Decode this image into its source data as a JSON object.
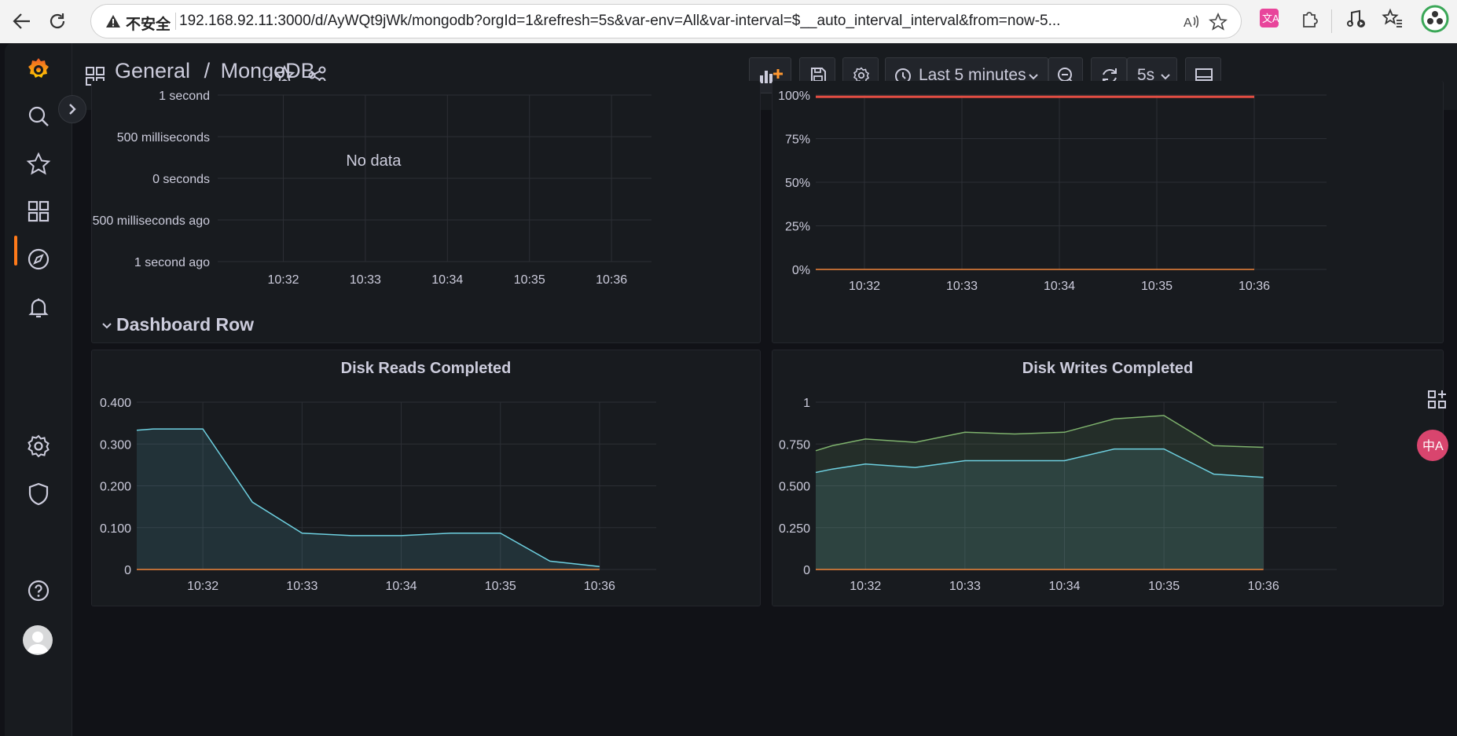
{
  "browser": {
    "insecure_label": "不安全",
    "url": "192.168.92.11:3000/d/AyWQt9jWk/mongodb?orgId=1&refresh=5s&var-env=All&var-interval=$__auto_interval_interval&from=now-5..."
  },
  "header": {
    "breadcrumb_folder": "General",
    "breadcrumb_sep": "/",
    "breadcrumb_dashboard": "MongoDB",
    "time_range": "Last 5 minutes",
    "refresh_interval": "5s"
  },
  "row": {
    "title": "Dashboard Row"
  },
  "colors": {
    "accent": "#ff7a1a",
    "series_cyan": "#6ed0e0",
    "series_green": "#7eb26d",
    "series_orange": "#ef843c",
    "series_red": "#e24d42"
  },
  "chart_data": [
    {
      "type": "line",
      "title": "",
      "no_data_label": "No data",
      "x_ticks": [
        "10:32",
        "10:33",
        "10:34",
        "10:35",
        "10:36"
      ],
      "y_ticks": [
        "1 second",
        "500 milliseconds",
        "0 seconds",
        "500 milliseconds ago",
        "1 second ago"
      ],
      "series": []
    },
    {
      "type": "line",
      "title": "",
      "x_ticks": [
        "10:32",
        "10:33",
        "10:34",
        "10:35",
        "10:36"
      ],
      "y_ticks": [
        "100%",
        "75%",
        "50%",
        "25%",
        "0%"
      ],
      "ylim": [
        0,
        100
      ],
      "x": [
        "10:31:30",
        "10:32",
        "10:32:30",
        "10:33",
        "10:33:30",
        "10:34",
        "10:34:30",
        "10:35",
        "10:35:30",
        "10:36"
      ],
      "series": [
        {
          "color": "#e24d42",
          "values": [
            99,
            99,
            99,
            99,
            99,
            99,
            99,
            99,
            99,
            99
          ]
        },
        {
          "color": "#ef843c",
          "values": [
            0,
            0,
            0,
            0,
            0,
            0,
            0,
            0,
            0,
            0
          ]
        }
      ]
    },
    {
      "type": "area",
      "title": "Disk Reads Completed",
      "x_ticks": [
        "10:32",
        "10:33",
        "10:34",
        "10:35",
        "10:36"
      ],
      "y_ticks": [
        "0.400",
        "0.300",
        "0.200",
        "0.100",
        "0"
      ],
      "ylim": [
        0,
        0.4
      ],
      "x": [
        "10:31:20",
        "10:31:30",
        "10:32",
        "10:32:30",
        "10:33",
        "10:33:30",
        "10:34",
        "10:34:30",
        "10:35",
        "10:35:30",
        "10:36"
      ],
      "series": [
        {
          "color": "#6ed0e0",
          "values": [
            0.333,
            0.336,
            0.336,
            0.161,
            0.087,
            0.081,
            0.081,
            0.087,
            0.087,
            0.02,
            0.007
          ]
        },
        {
          "color": "#ef843c",
          "values": [
            0,
            0,
            0,
            0,
            0,
            0,
            0,
            0,
            0,
            0,
            0
          ]
        }
      ]
    },
    {
      "type": "area",
      "title": "Disk Writes Completed",
      "x_ticks": [
        "10:32",
        "10:33",
        "10:34",
        "10:35",
        "10:36"
      ],
      "y_ticks": [
        "1",
        "0.750",
        "0.500",
        "0.250",
        "0"
      ],
      "ylim": [
        0,
        1
      ],
      "x": [
        "10:31:30",
        "10:31:40",
        "10:32",
        "10:32:30",
        "10:33",
        "10:33:30",
        "10:34",
        "10:34:30",
        "10:35",
        "10:35:30",
        "10:36"
      ],
      "series": [
        {
          "color": "#7eb26d",
          "values": [
            0.71,
            0.74,
            0.78,
            0.76,
            0.82,
            0.81,
            0.82,
            0.9,
            0.92,
            0.74,
            0.73
          ]
        },
        {
          "color": "#6ed0e0",
          "values": [
            0.58,
            0.6,
            0.63,
            0.61,
            0.65,
            0.65,
            0.65,
            0.72,
            0.72,
            0.57,
            0.55
          ]
        },
        {
          "color": "#ef843c",
          "values": [
            0,
            0,
            0,
            0,
            0,
            0,
            0,
            0,
            0,
            0,
            0
          ]
        }
      ]
    }
  ]
}
